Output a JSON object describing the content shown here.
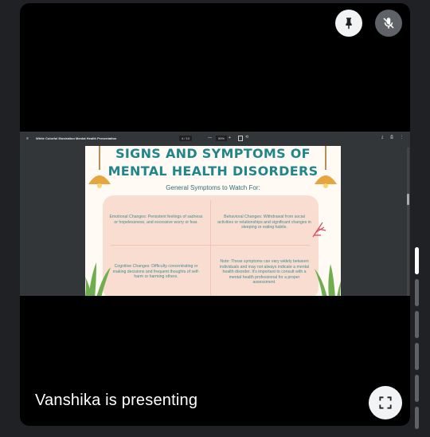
{
  "presenter_label": "Vanshika is presenting",
  "tile_controls": {
    "pin_icon": "pin-icon",
    "mic_icon": "mic-off-icon",
    "fullscreen_icon": "fullscreen-icon"
  },
  "pdf_toolbar": {
    "menu_glyph": "≡",
    "title": "White Colorful Illustration Mental Health Presentation",
    "page_indicator": "4 / 10",
    "zoom": "59%",
    "minus": "—",
    "plus": "+"
  },
  "slide": {
    "title_line1": "SIGNS AND SYMPTOMS OF",
    "title_line2": "MENTAL HEALTH DISORDERS",
    "subtitle": "General Symptoms to Watch For:",
    "cells": [
      "Emotional Changes: Persistent feelings of sadness or hopelessness, and excessive worry or fear.",
      "Behavioral Changes: Withdrawal from social activities or relationships and significant changes in sleeping or eating habits.",
      "Cognitive Changes: Difficulty concentrating or making decisions and frequent thoughts of self-harm or harming others.",
      "Note: These symptoms can vary widely between individuals and may not always indicate a mental health disorder. It's important to consult with a mental health professional for a proper assessment."
    ]
  },
  "colors": {
    "accent_teal": "#21868a",
    "card_peach": "#f9ddd0",
    "slide_bg": "#fffaf4"
  }
}
